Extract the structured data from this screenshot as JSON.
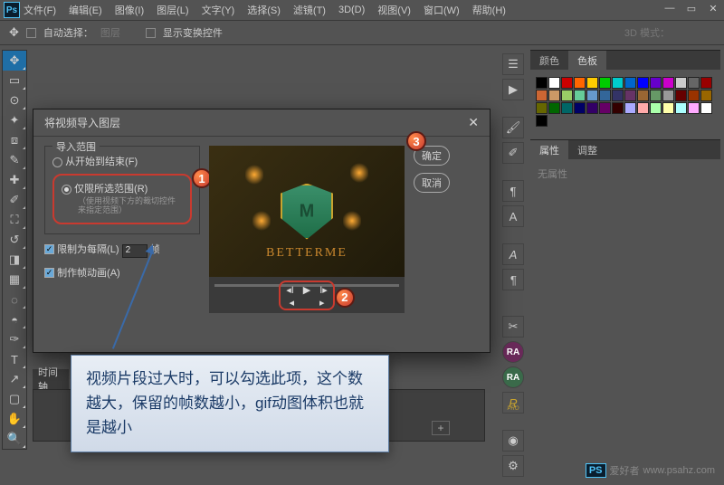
{
  "menu": {
    "file": "文件(F)",
    "edit": "编辑(E)",
    "image": "图像(I)",
    "layer": "图层(L)",
    "text": "文字(Y)",
    "select": "选择(S)",
    "filter": "滤镜(T)",
    "threeD": "3D(D)",
    "view": "视图(V)",
    "window": "窗口(W)",
    "help": "帮助(H)"
  },
  "optbar": {
    "autoselect": "自动选择：",
    "layer": "图层",
    "showcontrols": "显示变换控件",
    "mode3d": "3D 模式："
  },
  "dialog": {
    "title": "将视频导入图层",
    "import_range": "导入范围",
    "begin_to_end": "从开始到结束(F)",
    "selected_range": "仅限所选范围(R)",
    "hint": "（使用视频下方的裁切控件来指定范围）",
    "limit_every": "限制为每隔(L)",
    "limit_value": "2",
    "frames_unit": "帧",
    "make_anim": "制作帧动画(A)",
    "ok": "确定",
    "cancel": "取消",
    "preview_text": "BETTERME"
  },
  "badges": {
    "one": "1",
    "two": "2",
    "three": "3"
  },
  "callout": "视频片段过大时，可以勾选此项，这个数越大，保留的帧数越小，gif动图体积也就是越小",
  "panels": {
    "color": "颜色",
    "swatches": "色板",
    "props": "属性",
    "adjust": "调整",
    "no_props": "无属性"
  },
  "swatchColors": [
    "#000",
    "#fff",
    "#c00",
    "#f60",
    "#fc0",
    "#0c0",
    "#0cc",
    "#06c",
    "#00f",
    "#60c",
    "#c0c",
    "#ccc",
    "#666",
    "#900",
    "#c63",
    "#c96",
    "#9c6",
    "#6c9",
    "#69c",
    "#369",
    "#336",
    "#636",
    "#963",
    "#696",
    "#999",
    "#600",
    "#930",
    "#960",
    "#660",
    "#060",
    "#066",
    "#006",
    "#306",
    "#606",
    "#300",
    "#aaf",
    "#faa",
    "#afa",
    "#ffa",
    "#aff",
    "#faf",
    "#fff",
    "#000"
  ],
  "timeline": "时间轴",
  "watermark": {
    "ps": "PS",
    "text": "爱好者",
    "url": "www.psahz.com"
  },
  "right_strip": {
    "ra": "RA",
    "r": "R",
    "pro": "PRO"
  }
}
